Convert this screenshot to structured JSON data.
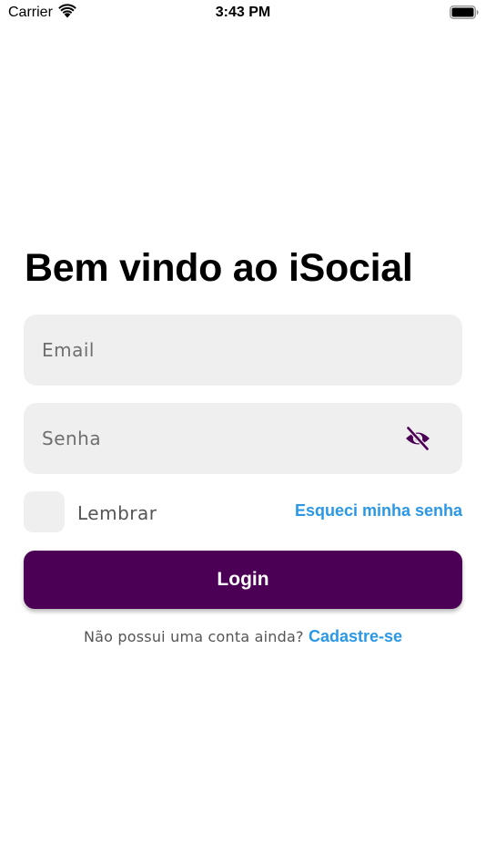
{
  "status_bar": {
    "carrier": "Carrier",
    "time": "3:43 PM",
    "wifi_icon": "wifi-icon",
    "battery_icon": "battery-full-icon"
  },
  "login": {
    "title": "Bem vindo ao iSocial",
    "email": {
      "placeholder": "Email",
      "value": ""
    },
    "password": {
      "placeholder": "Senha",
      "value": "",
      "toggle_icon": "eye-slash-icon"
    },
    "remember": {
      "label": "Lembrar",
      "checked": false
    },
    "forgot_password": "Esqueci minha senha",
    "login_button": "Login",
    "signup_question": "Não possui uma conta ainda?",
    "signup_link": "Cadastre-se"
  },
  "colors": {
    "primary": "#4b0055",
    "link": "#2a98e6",
    "field_background": "#efefef"
  }
}
